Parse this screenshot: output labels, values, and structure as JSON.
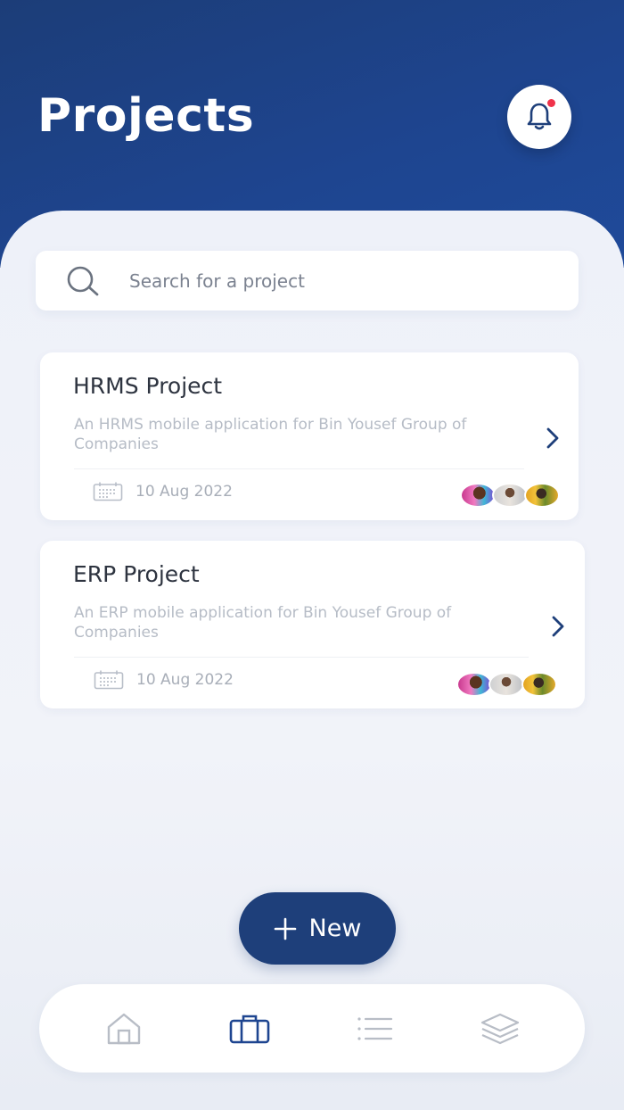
{
  "header": {
    "title": "Projects",
    "notification_badge": true
  },
  "search": {
    "placeholder": "Search for a project"
  },
  "projects": [
    {
      "title": "HRMS Project",
      "description": "An HRMS mobile application for Bin Yousef Group of Companies",
      "date": "10 Aug 2022",
      "member_count": 3
    },
    {
      "title": "ERP Project",
      "description": "An ERP mobile application for Bin Yousef Group of Companies",
      "date": "10 Aug 2022",
      "member_count": 3
    }
  ],
  "new_button": {
    "label": "New",
    "icon": "plus-icon"
  },
  "bottom_nav": {
    "items": [
      {
        "icon": "home-icon",
        "active": false
      },
      {
        "icon": "briefcase-icon",
        "active": true
      },
      {
        "icon": "list-icon",
        "active": false
      },
      {
        "icon": "layers-icon",
        "active": false
      }
    ]
  },
  "colors": {
    "header_start": "#1c3d78",
    "header_end": "#1f4a9a",
    "accent": "#1e3f7a",
    "notification_dot": "#f0334b",
    "background": "#eef1f8"
  }
}
